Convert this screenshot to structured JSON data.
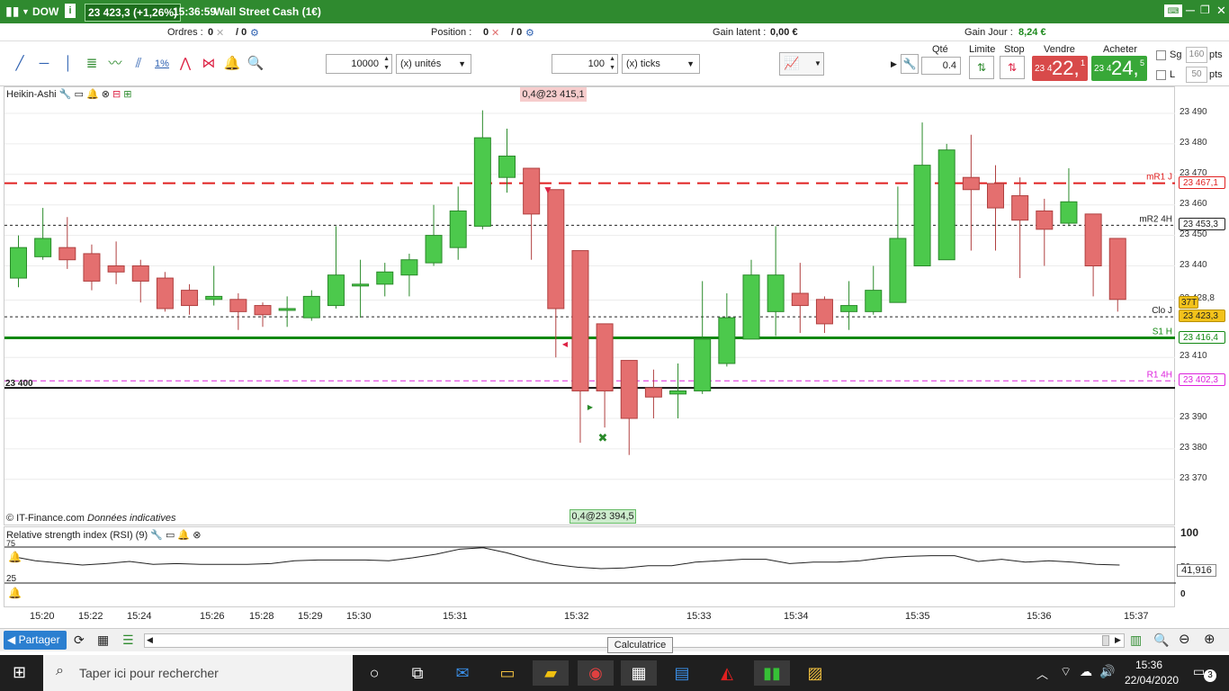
{
  "window": {
    "symbol": "DOW",
    "price_change": "23 423,3 (+1,26%)",
    "time": "15:36:59",
    "instrument": "Wall Street Cash (1€)"
  },
  "infobar": {
    "orders_label": "Ordres :",
    "orders_count": "0",
    "orders_sep": "/ 0",
    "position_label": "Position :",
    "position_count": "0",
    "position_sep": "/ 0",
    "latent_label": "Gain latent :",
    "latent_value": "0,00 €",
    "daily_label": "Gain Jour :",
    "daily_value": "8,24 €"
  },
  "toolbar": {
    "qty_units": "10000",
    "units_select": "(x) unités",
    "qty_ticks": "100",
    "ticks_select": "(x) ticks",
    "qte_label": "Qté",
    "qte_value": "0.4",
    "limite_label": "Limite",
    "stop_label": "Stop",
    "vendre_label": "Vendre",
    "acheter_label": "Acheter",
    "sell_small": "23 4",
    "sell_big": "22,",
    "sell_sup": "1",
    "buy_small": "23 4",
    "buy_big": "24,",
    "buy_sup": "5",
    "sg_label": "Sg",
    "sg_value": "160",
    "l_label": "L",
    "l_value": "50",
    "pts1": "pts",
    "pts2": "pts",
    "percent_icon": "1%"
  },
  "chart": {
    "indicator_label": "Heikin-Ashi",
    "copyright": "© IT-Finance.com",
    "note": "Données indicatives",
    "order_top": "0,4@23 415,1",
    "order_bottom": "0,4@23 394,5",
    "label_23400": "23 400"
  },
  "chart_data": {
    "type": "candlestick",
    "y_ticks": [
      "23 490",
      "23 480",
      "23 470",
      "23 460",
      "23 450",
      "23 440",
      "23 428,8",
      "23 410",
      "23 390",
      "23 380",
      "23 370"
    ],
    "levels": [
      {
        "name": "mR1 J",
        "value": "23 467,1",
        "color": "#e02020"
      },
      {
        "name": "mR2 4H",
        "value": "23 453,3",
        "color": "#222222"
      },
      {
        "name": "Clo J",
        "value": "23 423,3",
        "color": "#222222"
      },
      {
        "name": "S1 H",
        "value": "23 416,4",
        "color": "#118811"
      },
      {
        "name": "R1 4H",
        "value": "23 402,3",
        "color": "#dd22dd"
      }
    ],
    "cur_tag": "37T",
    "candles": [
      {
        "o": 23436,
        "c": 23446,
        "h": 23450,
        "l": 23433
      },
      {
        "o": 23443,
        "c": 23449,
        "h": 23459,
        "l": 23442
      },
      {
        "o": 23446,
        "c": 23442,
        "h": 23456,
        "l": 23439
      },
      {
        "o": 23444,
        "c": 23435,
        "h": 23447,
        "l": 23432
      },
      {
        "o": 23440,
        "c": 23438,
        "h": 23448,
        "l": 23434
      },
      {
        "o": 23440,
        "c": 23435,
        "h": 23442,
        "l": 23428
      },
      {
        "o": 23436,
        "c": 23426,
        "h": 23438,
        "l": 23425
      },
      {
        "o": 23432,
        "c": 23427,
        "h": 23434,
        "l": 23424
      },
      {
        "o": 23429,
        "c": 23430,
        "h": 23440,
        "l": 23427
      },
      {
        "o": 23429,
        "c": 23425,
        "h": 23431,
        "l": 23419
      },
      {
        "o": 23427,
        "c": 23424,
        "h": 23428,
        "l": 23420
      },
      {
        "o": 23426,
        "c": 23426,
        "h": 23430,
        "l": 23420
      },
      {
        "o": 23423,
        "c": 23430,
        "h": 23432,
        "l": 23422
      },
      {
        "o": 23427,
        "c": 23437,
        "h": 23453,
        "l": 23426
      },
      {
        "o": 23434,
        "c": 23434,
        "h": 23442,
        "l": 23423
      },
      {
        "o": 23434,
        "c": 23438,
        "h": 23441,
        "l": 23430
      },
      {
        "o": 23437,
        "c": 23442,
        "h": 23444,
        "l": 23430
      },
      {
        "o": 23441,
        "c": 23450,
        "h": 23460,
        "l": 23440
      },
      {
        "o": 23446,
        "c": 23458,
        "h": 23466,
        "l": 23442
      },
      {
        "o": 23453,
        "c": 23482,
        "h": 23491,
        "l": 23452
      },
      {
        "o": 23469,
        "c": 23476,
        "h": 23485,
        "l": 23464
      },
      {
        "o": 23472,
        "c": 23457,
        "h": 23472,
        "l": 23442
      },
      {
        "o": 23465,
        "c": 23426,
        "h": 23465,
        "l": 23410
      },
      {
        "o": 23445,
        "c": 23399,
        "h": 23445,
        "l": 23382
      },
      {
        "o": 23421,
        "c": 23399,
        "h": 23421,
        "l": 23387
      },
      {
        "o": 23409,
        "c": 23390,
        "h": 23409,
        "l": 23378
      },
      {
        "o": 23400,
        "c": 23397,
        "h": 23406,
        "l": 23390
      },
      {
        "o": 23398,
        "c": 23399,
        "h": 23408,
        "l": 23390
      },
      {
        "o": 23399,
        "c": 23416,
        "h": 23435,
        "l": 23398
      },
      {
        "o": 23408,
        "c": 23423,
        "h": 23431,
        "l": 23407
      },
      {
        "o": 23416,
        "c": 23437,
        "h": 23442,
        "l": 23416
      },
      {
        "o": 23425,
        "c": 23437,
        "h": 23453,
        "l": 23417
      },
      {
        "o": 23431,
        "c": 23427,
        "h": 23441,
        "l": 23418
      },
      {
        "o": 23429,
        "c": 23421,
        "h": 23430,
        "l": 23418
      },
      {
        "o": 23425,
        "c": 23427,
        "h": 23435,
        "l": 23419
      },
      {
        "o": 23425,
        "c": 23432,
        "h": 23440,
        "l": 23424
      },
      {
        "o": 23428,
        "c": 23449,
        "h": 23466,
        "l": 23428
      },
      {
        "o": 23440,
        "c": 23473,
        "h": 23487,
        "l": 23440
      },
      {
        "o": 23442,
        "c": 23478,
        "h": 23480,
        "l": 23442
      },
      {
        "o": 23469,
        "c": 23465,
        "h": 23483,
        "l": 23445
      },
      {
        "o": 23467,
        "c": 23459,
        "h": 23473,
        "l": 23445
      },
      {
        "o": 23463,
        "c": 23455,
        "h": 23469,
        "l": 23436
      },
      {
        "o": 23458,
        "c": 23452,
        "h": 23462,
        "l": 23440
      },
      {
        "o": 23454,
        "c": 23461,
        "h": 23472,
        "l": 23453
      },
      {
        "o": 23457,
        "c": 23440,
        "h": 23457,
        "l": 23430
      },
      {
        "o": 23449,
        "c": 23429,
        "h": 23449,
        "l": 23425
      }
    ],
    "x_ticks": [
      "15:20",
      "15:22",
      "15:24",
      "15:26",
      "15:28",
      "15:29",
      "15:30",
      "15:31",
      "15:32",
      "15:33",
      "15:34",
      "15:35",
      "15:36",
      "15:37"
    ]
  },
  "rsi": {
    "label": "Relative strength index (RSI) (9)",
    "level_top": "75",
    "level_bottom": "25",
    "axis_top": "100",
    "axis_mid": "50",
    "value": "41,916",
    "axis_bottom": "0",
    "values": [
      62,
      56,
      53,
      50,
      52,
      55,
      51,
      52,
      51,
      51,
      51,
      52,
      56,
      57,
      57,
      57,
      56,
      60,
      65,
      72,
      74,
      67,
      58,
      51,
      47,
      45,
      46,
      49,
      49,
      54,
      56,
      58,
      58,
      52,
      54,
      54,
      56,
      60,
      62,
      63,
      63,
      55,
      58,
      54,
      56,
      54,
      51,
      50
    ]
  },
  "bottombar": {
    "share_label": "Partager"
  },
  "tooltip": {
    "text": "Calculatrice"
  },
  "taskbar": {
    "search_placeholder": "Taper ici pour rechercher",
    "clock_time": "15:36",
    "clock_date": "22/04/2020",
    "notif_count": "3"
  }
}
